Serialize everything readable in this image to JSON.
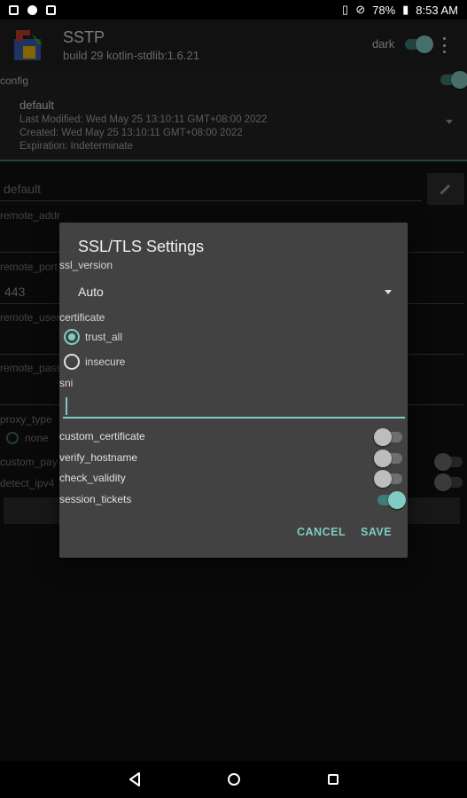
{
  "statusbar": {
    "battery": "78%",
    "time": "8:53 AM"
  },
  "appbar": {
    "title": "SSTP",
    "subtitle": "build 29 kotlin-stdlib:1.6.21",
    "dark_label": "dark",
    "dark_on": true,
    "overflow_icon": "more-vert-icon",
    "logo_icon": "app-logo-icon"
  },
  "config": {
    "label": "config",
    "enabled": true,
    "profile_name": "default",
    "last_modified": "Last Modified: Wed May 25 13:10:11 GMT+08:00 2022",
    "created": "Created: Wed May 25 13:10:11 GMT+08:00 2022",
    "expiration": "Expiration: Indeterminate"
  },
  "background_form": {
    "name_value": "default",
    "remote_addr_label": "remote_addr",
    "remote_port_label": "remote_port",
    "remote_port_value": "443",
    "remote_user_label": "remote_user",
    "remote_pass_label": "remote_pass",
    "proxy_type_label": "proxy_type",
    "proxy_none_label": "none",
    "custom_pay_label": "custom_pay",
    "detect_ipv4_label": "detect_ipv4",
    "edit_icon": "pencil-icon"
  },
  "dialog": {
    "title": "SSL/TLS Settings",
    "ssl_version_label": "ssl_version",
    "ssl_version_value": "Auto",
    "certificate_label": "certificate",
    "options": [
      {
        "label": "trust_all",
        "checked": true
      },
      {
        "label": "insecure",
        "checked": false
      }
    ],
    "sni_label": "sni",
    "sni_value": "",
    "toggles": [
      {
        "label": "custom_certificate",
        "on": false
      },
      {
        "label": "verify_hostname",
        "on": false
      },
      {
        "label": "check_validity",
        "on": false
      },
      {
        "label": "session_tickets",
        "on": true
      }
    ],
    "cancel_label": "CANCEL",
    "save_label": "SAVE"
  },
  "colors": {
    "accent": "#80cbc4",
    "dialog_bg": "#424242",
    "app_bg": "#121212"
  }
}
